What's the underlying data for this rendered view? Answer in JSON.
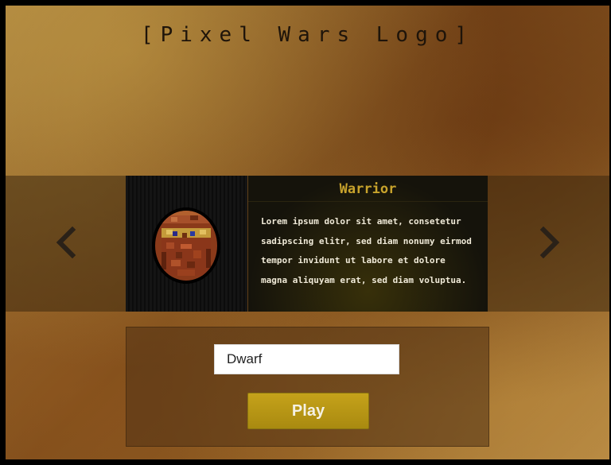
{
  "logo": {
    "text": "[Pixel Wars Logo]"
  },
  "carousel": {
    "prev_icon": "chevron-left-icon",
    "next_icon": "chevron-right-icon",
    "portrait_icon": "dwarf-warrior-portrait",
    "title": "Warrior",
    "description_lines": [
      "Lorem ipsum dolor sit amet, consetetur",
      "sadipscing elitr, sed diam nonumy eirmod",
      "tempor invidunt ut labore et dolore",
      "magna aliquyam erat, sed diam voluptua."
    ]
  },
  "form": {
    "name_value": "Dwarf",
    "play_label": "Play"
  },
  "colors": {
    "title_gold": "#c8a32c",
    "button_gold": "#b89612",
    "arrow": "#2a2118"
  }
}
